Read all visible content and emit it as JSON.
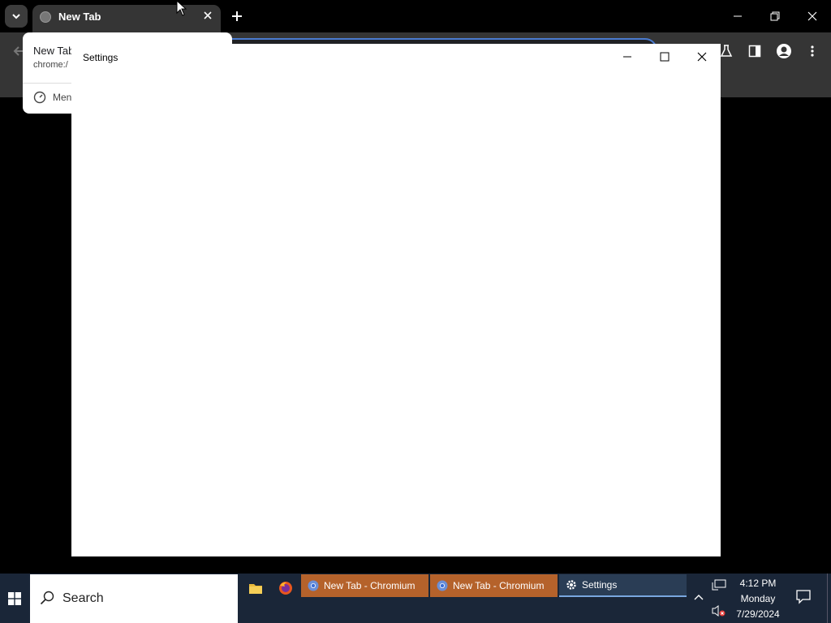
{
  "browser": {
    "tab": {
      "title": "New Tab"
    },
    "hover_card": {
      "title": "New Tab",
      "url": "chrome:/",
      "memory": "Men"
    }
  },
  "settings_window": {
    "title": "Settings"
  },
  "taskbar": {
    "search_label": "Search",
    "items": [
      {
        "label": "New Tab - Chromium"
      },
      {
        "label": "New Tab - Chromium"
      },
      {
        "label": "Settings"
      }
    ],
    "clock": {
      "time": "4:12 PM",
      "day": "Monday",
      "date": "7/29/2024"
    }
  },
  "colors": {
    "taskbar_bg": "#1a2638",
    "chromium_task_bg": "#b5622b",
    "active_task_bg": "#2a3d55",
    "accent_blue": "#4a7bd0"
  }
}
